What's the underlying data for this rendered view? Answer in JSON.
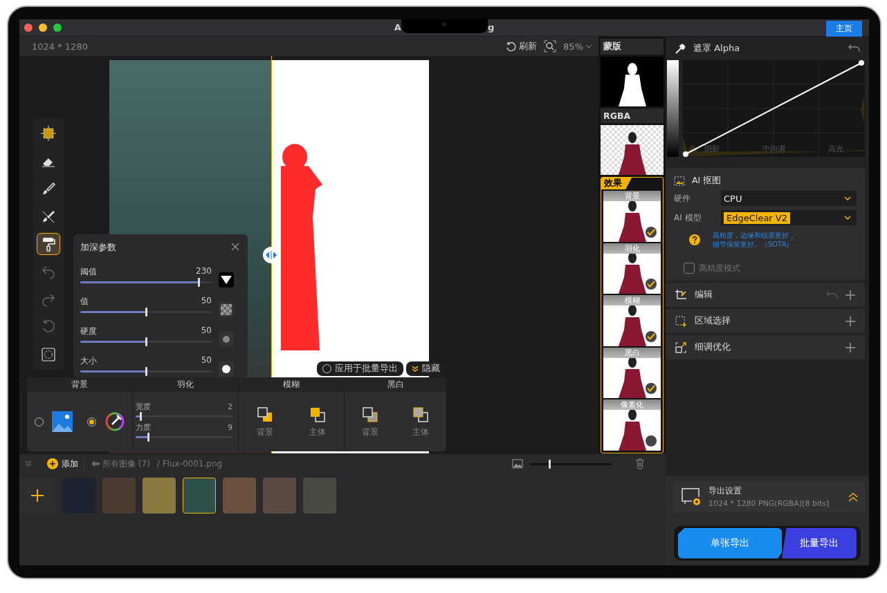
{
  "window": {
    "title_fragments": [
      "A",
      "g"
    ],
    "home_button": "主页"
  },
  "toolbar": {
    "dimensions": "1024 * 1280",
    "refresh": "刷新",
    "zoom": "85%"
  },
  "tools": [
    {
      "kind": "select",
      "selected": false,
      "disabled": false
    },
    {
      "kind": "eraser",
      "selected": false,
      "disabled": false
    },
    {
      "kind": "brush",
      "selected": false,
      "disabled": false
    },
    {
      "kind": "brush-erase",
      "selected": false,
      "disabled": false
    },
    {
      "kind": "roller",
      "selected": true,
      "disabled": false
    },
    {
      "kind": "undo",
      "selected": false,
      "disabled": true
    },
    {
      "kind": "redo",
      "selected": false,
      "disabled": true
    },
    {
      "kind": "reset",
      "selected": false,
      "disabled": true
    },
    {
      "kind": "lasso",
      "selected": false,
      "disabled": false
    }
  ],
  "popover": {
    "title": "加深参数",
    "sliders": [
      {
        "label": "阈值",
        "reading": "230",
        "level": 0.9
      },
      {
        "label": "值",
        "reading": "50",
        "level": 0.5
      },
      {
        "label": "硬度",
        "reading": "50",
        "level": 0.5
      },
      {
        "label": "大小",
        "reading": "50",
        "level": 0.5
      }
    ]
  },
  "canvas_buttons": {
    "apply_batch": {
      "label": "应用于批量导出",
      "checked": false
    },
    "hide": "隐藏"
  },
  "effects_panel": {
    "background": {
      "title": "背景",
      "options": [
        {
          "kind": "image",
          "selected": false
        },
        {
          "kind": "color",
          "selected": true
        }
      ]
    },
    "feather": {
      "title": "羽化",
      "sliders": [
        {
          "label": "宽度",
          "reading": "2",
          "level": 0.05
        },
        {
          "label": "力度",
          "reading": "9",
          "level": 0.13
        }
      ]
    },
    "blur": {
      "title": "模糊",
      "options": [
        {
          "label": "背景"
        },
        {
          "label": "主体"
        }
      ]
    },
    "bw": {
      "title": "黑白",
      "options": [
        {
          "label": "背景"
        },
        {
          "label": "主体"
        }
      ]
    }
  },
  "preview": {
    "mask_label": "蒙版",
    "rgba_label": "RGBA",
    "effects_label": "效果",
    "effects": [
      {
        "label": "背景",
        "checked": true
      },
      {
        "label": "羽化",
        "checked": true
      },
      {
        "label": "模糊",
        "checked": true
      },
      {
        "label": "黑白",
        "checked": true
      },
      {
        "label": "像素化",
        "checked": false
      }
    ]
  },
  "alpha": {
    "title": "遮罩 Alpha",
    "zones": [
      "阴影",
      "中间调",
      "高光"
    ]
  },
  "ai_cutout": {
    "title": "AI 抠图",
    "hardware_label": "硬件",
    "hardware": "CPU",
    "model_label": "AI 模型",
    "model": "EdgeClear  V2",
    "hint_lines": [
      "高精度，边缘和锐度更好，",
      "细节保留更好。（SOTA）"
    ],
    "hq_mode": {
      "label": "高精度模式",
      "checked": false,
      "disabled": true
    }
  },
  "sections": [
    {
      "kind": "edit",
      "label": "编辑"
    },
    {
      "kind": "region",
      "label": "区域选择"
    },
    {
      "kind": "refine",
      "label": "细调优化"
    }
  ],
  "export": {
    "title": "导出设置",
    "detail": "1024 * 1280 PNG(RGBA)[8 bits]",
    "single": "单张导出",
    "batch": "批量导出"
  },
  "library": {
    "add": "添加",
    "breadcrumb": "所有图像 (7)",
    "file": "/ Flux-0001.png",
    "thumb_size": {
      "level": 0.24
    },
    "thumbnails": [
      {
        "selected": false
      },
      {
        "selected": false
      },
      {
        "selected": false
      },
      {
        "selected": true
      },
      {
        "selected": false
      },
      {
        "selected": false
      },
      {
        "selected": false
      }
    ]
  }
}
